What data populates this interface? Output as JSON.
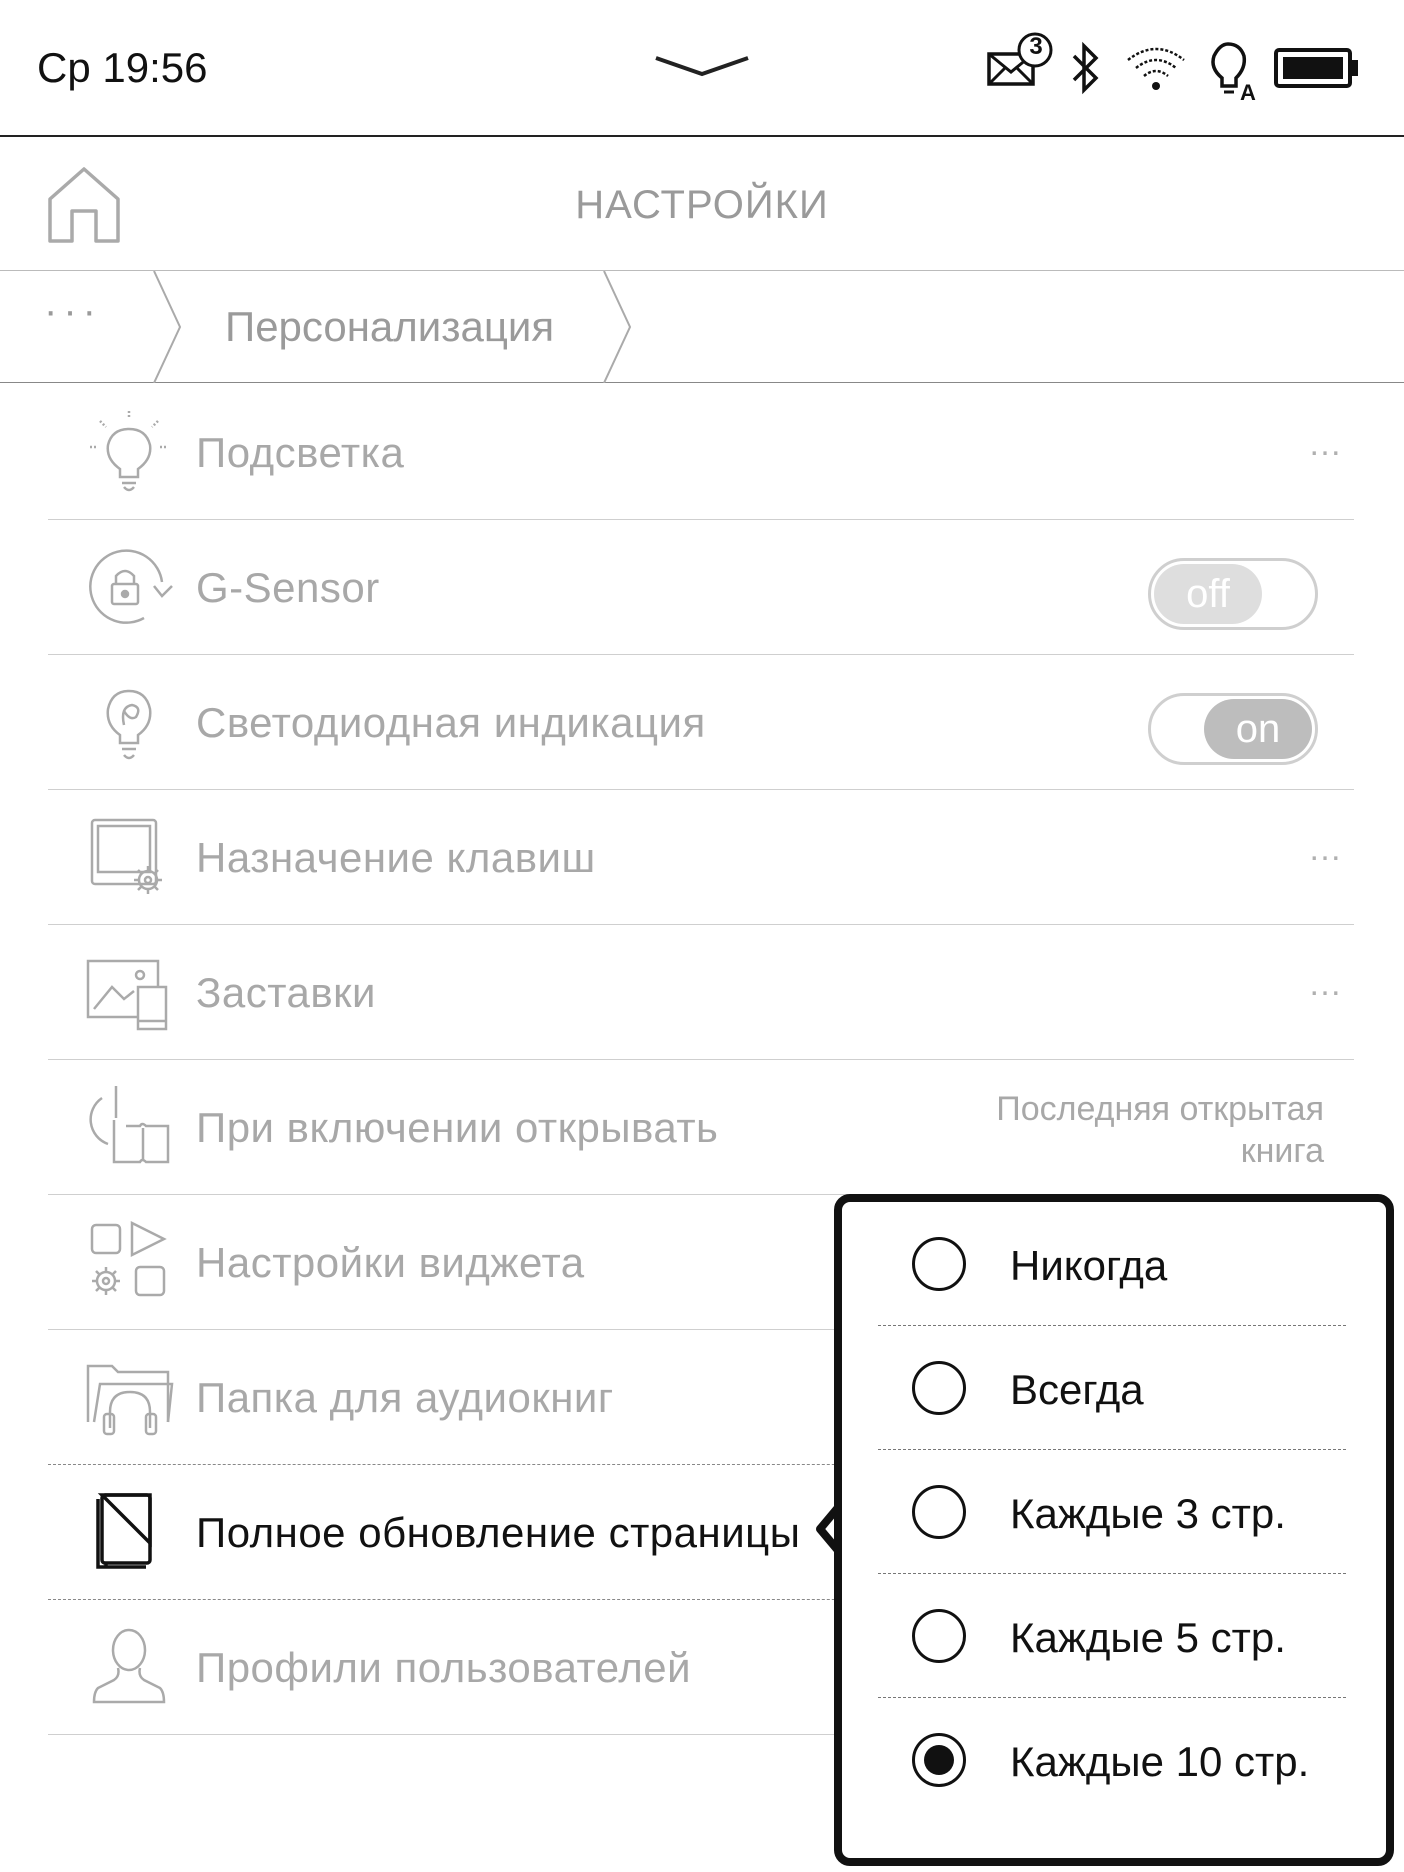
{
  "status_bar": {
    "time": "Ср 19:56",
    "mail_count": "3",
    "icons": [
      "mail-icon",
      "bluetooth-icon",
      "wifi-icon",
      "auto-light-icon",
      "battery-icon"
    ]
  },
  "header": {
    "title": "НАСТРОЙКИ"
  },
  "breadcrumb": {
    "more": "···",
    "current": "Персонализация"
  },
  "settings": [
    {
      "label": "Подсветка",
      "icon": "lightbulb-icon",
      "trailing": "…"
    },
    {
      "label": "G-Sensor",
      "icon": "rotation-lock-icon",
      "toggle": "off"
    },
    {
      "label": "Светодиодная индикация",
      "icon": "led-bulb-icon",
      "toggle": "on"
    },
    {
      "label": "Назначение клавиш",
      "icon": "key-mapping-icon",
      "trailing": "…"
    },
    {
      "label": "Заставки",
      "icon": "screensaver-icon",
      "trailing": "…"
    },
    {
      "label": "При включении открывать",
      "icon": "power-book-icon",
      "value_line1": "Последняя открытая",
      "value_line2": "книга"
    },
    {
      "label": "Настройки виджета",
      "icon": "widget-settings-icon"
    },
    {
      "label": "Папка для аудиокниг",
      "icon": "audiobook-folder-icon"
    },
    {
      "label": "Полное обновление страницы",
      "icon": "page-refresh-icon"
    },
    {
      "label": "Профили пользователей",
      "icon": "user-profile-icon"
    }
  ],
  "popup": {
    "options": [
      {
        "label": "Никогда",
        "selected": false
      },
      {
        "label": "Всегда",
        "selected": false
      },
      {
        "label": "Каждые 3 стр.",
        "selected": false
      },
      {
        "label": "Каждые 5 стр.",
        "selected": false
      },
      {
        "label": "Каждые 10 стр.",
        "selected": true
      }
    ]
  }
}
